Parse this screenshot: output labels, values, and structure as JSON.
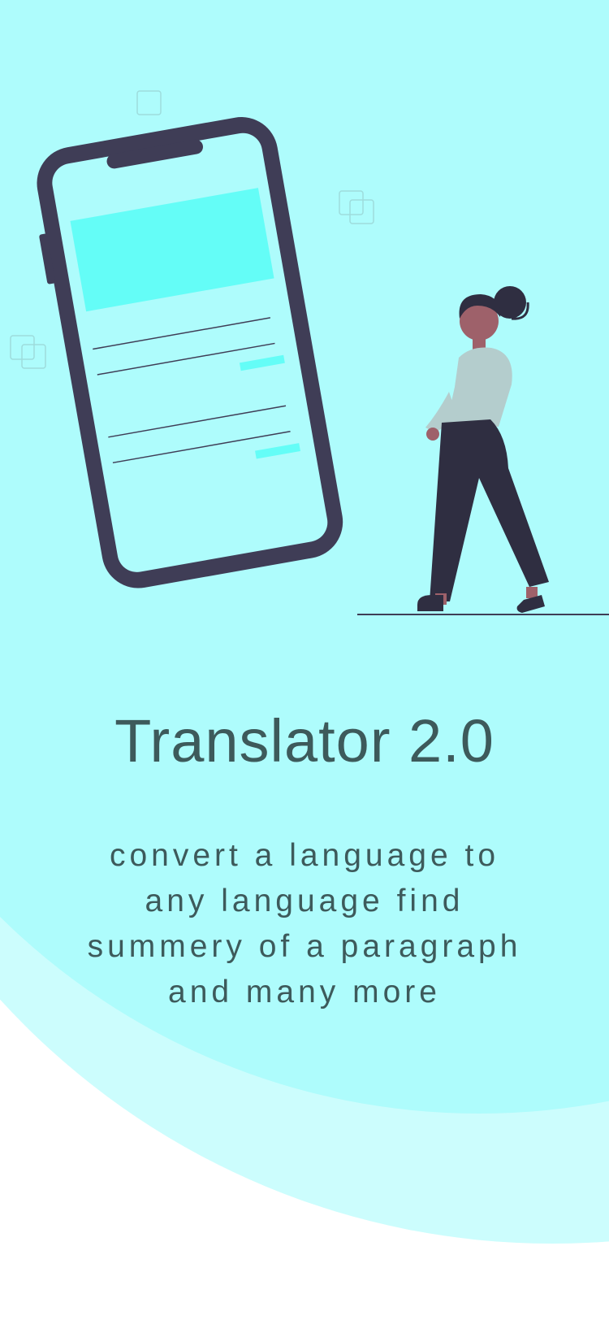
{
  "onboarding": {
    "title": "Translator 2.0",
    "description": "convert a language to any language find summery of a paragraph and many more"
  },
  "colors": {
    "background": "#ffffff",
    "outer_circle": "#ccfdfd",
    "inner_circle": "#aefcfc",
    "accent": "#64fdf7",
    "phone_frame": "#3f3d56",
    "text": "#3d5a5b"
  },
  "icons": [
    "phone-illustration",
    "person-illustration",
    "square-outline-icon"
  ]
}
